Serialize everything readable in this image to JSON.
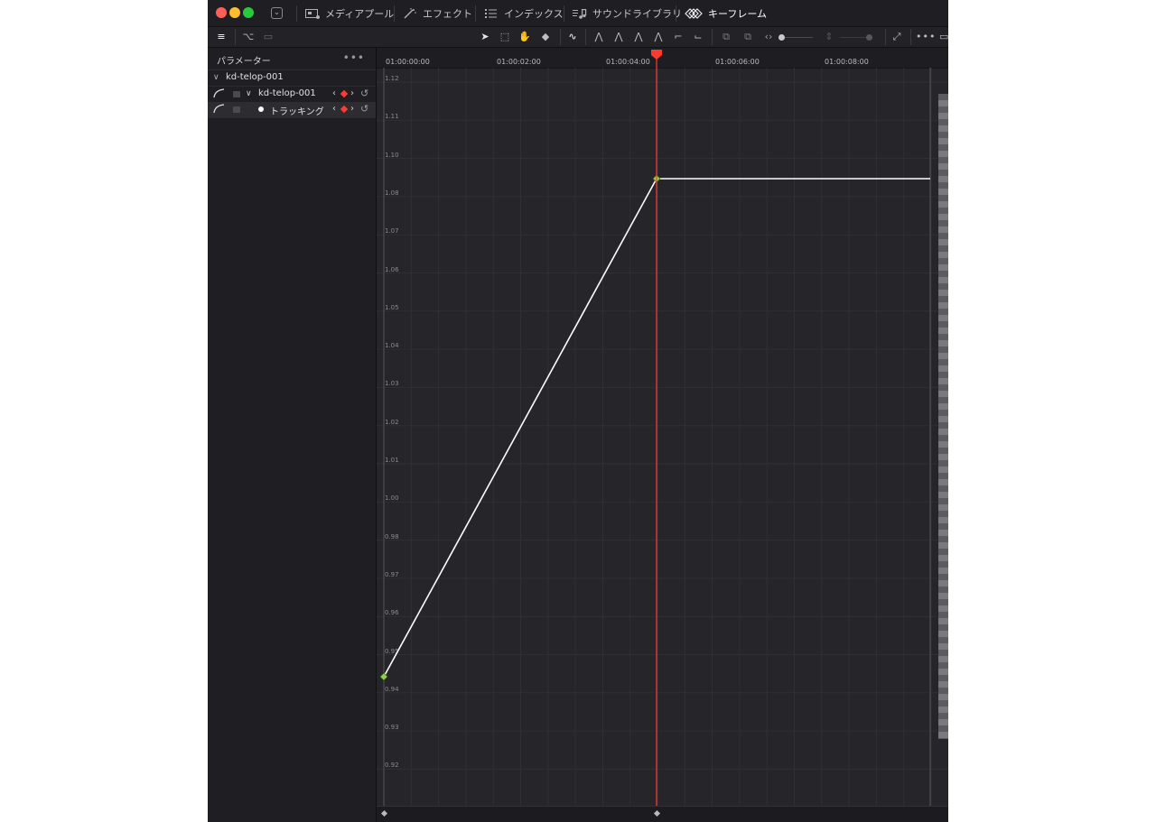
{
  "topbar": {
    "tabs": [
      {
        "label": "メディアプール",
        "icon": "media-pool-icon"
      },
      {
        "label": "エフェクト",
        "icon": "effects-wand-icon"
      },
      {
        "label": "インデックス",
        "icon": "index-list-icon"
      },
      {
        "label": "サウンドライブラリ",
        "icon": "sound-library-icon"
      },
      {
        "label": "キーフレーム",
        "icon": "keyframes-icon"
      }
    ]
  },
  "params": {
    "title": "パラメーター",
    "menu_dots": "•••",
    "group": "kd-telop-001",
    "rows": [
      {
        "label": "kd-telop-001"
      },
      {
        "label": "トラッキング"
      }
    ],
    "nav_prev": "‹",
    "nav_next": "›"
  },
  "graph": {
    "timecodes": [
      "01:00:00:00",
      "01:00:02:00",
      "01:00:04:00",
      "01:00:06:00",
      "01:00:08:00"
    ],
    "y_labels": [
      "1.12",
      "1.11",
      "1.10",
      "1.08",
      "1.07",
      "1.06",
      "1.05",
      "1.04",
      "1.03",
      "1.02",
      "1.01",
      "1.00",
      "0.98",
      "0.97",
      "0.96",
      "0.95",
      "0.94",
      "0.93",
      "0.92"
    ],
    "keyframe_values": [
      0.945,
      1.085
    ],
    "playhead_color": "#ff3b30",
    "curve_color": "#ffffff",
    "keyframe_color": "#8fd14f"
  }
}
